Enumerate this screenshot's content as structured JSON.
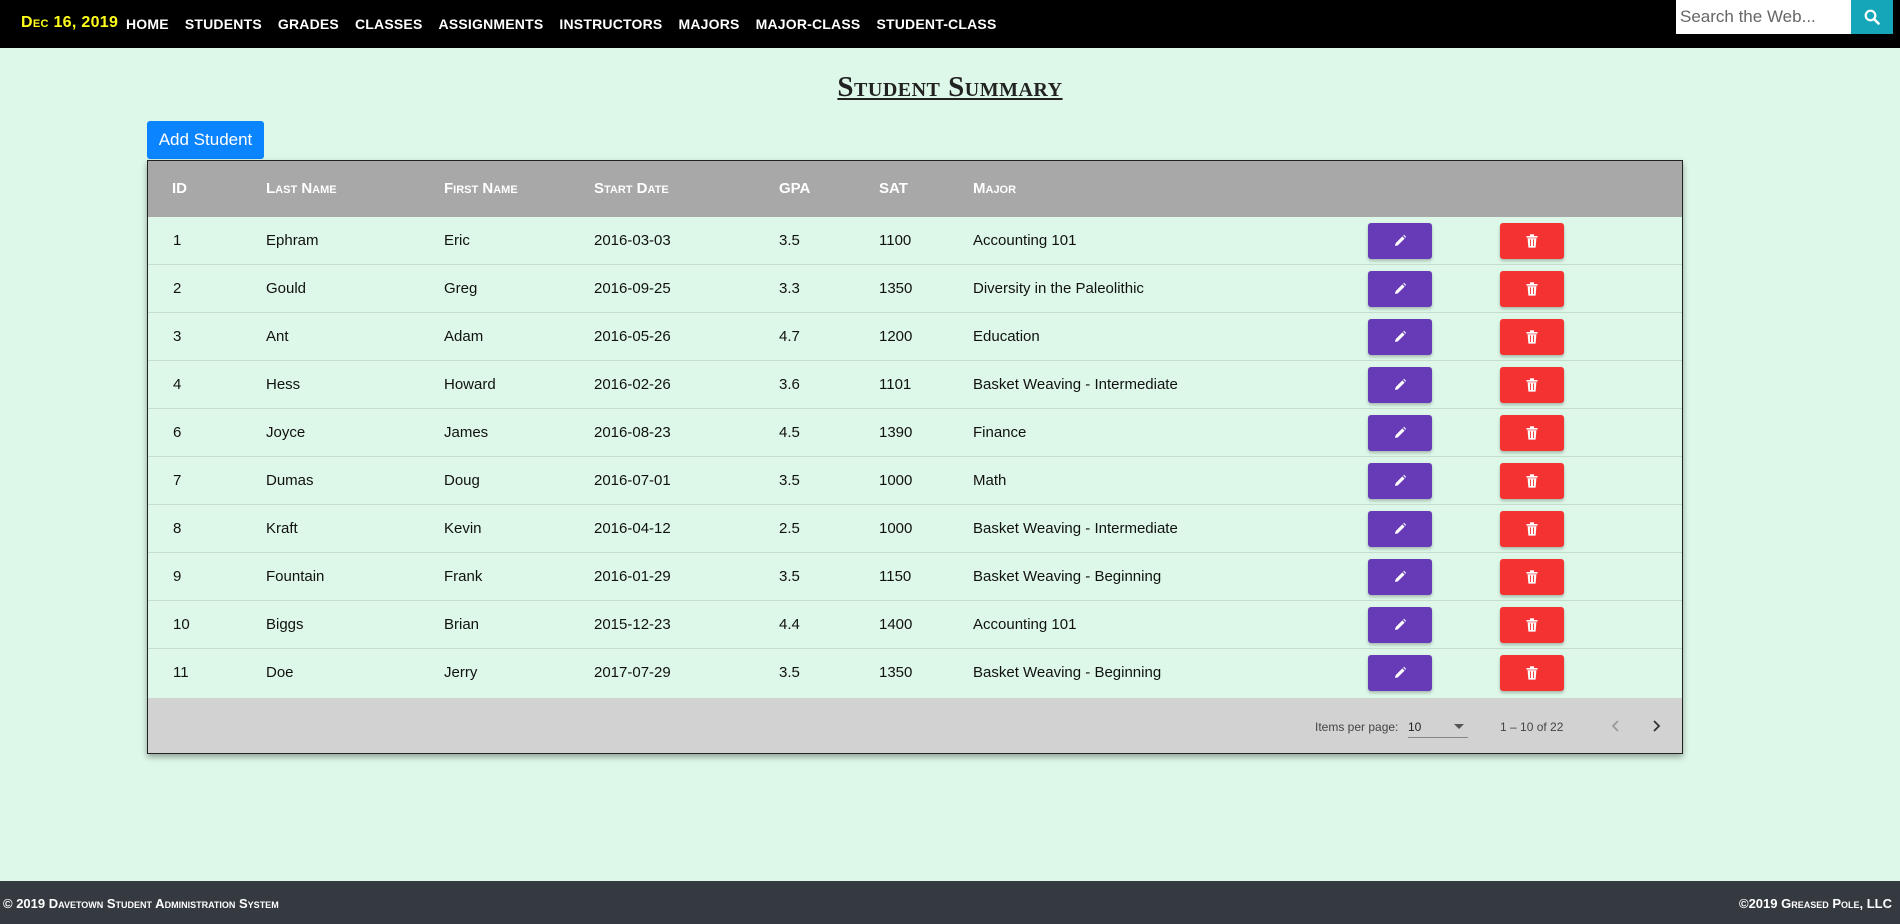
{
  "navbar": {
    "date": "Dec 16, 2019",
    "links": [
      "HOME",
      "STUDENTS",
      "GRADES",
      "CLASSES",
      "ASSIGNMENTS",
      "INSTRUCTORS",
      "MAJORS",
      "MAJOR-CLASS",
      "STUDENT-CLASS"
    ],
    "search_placeholder": "Search the Web...",
    "search_icon": "search-icon"
  },
  "page": {
    "title": "Student Summary",
    "add_button_label": "Add Student"
  },
  "table": {
    "headers": {
      "id": "ID",
      "last_name": "Last Name",
      "first_name": "First Name",
      "start_date": "Start Date",
      "gpa": "GPA",
      "sat": "SAT",
      "major": "Major"
    },
    "rows": [
      {
        "id": "1",
        "last_name": "Ephram",
        "first_name": "Eric",
        "start_date": "2016-03-03",
        "gpa": "3.5",
        "sat": "1100",
        "major": "Accounting 101"
      },
      {
        "id": "2",
        "last_name": "Gould",
        "first_name": "Greg",
        "start_date": "2016-09-25",
        "gpa": "3.3",
        "sat": "1350",
        "major": "Diversity in the Paleolithic"
      },
      {
        "id": "3",
        "last_name": "Ant",
        "first_name": "Adam",
        "start_date": "2016-05-26",
        "gpa": "4.7",
        "sat": "1200",
        "major": "Education"
      },
      {
        "id": "4",
        "last_name": "Hess",
        "first_name": "Howard",
        "start_date": "2016-02-26",
        "gpa": "3.6",
        "sat": "1101",
        "major": "Basket Weaving - Intermediate"
      },
      {
        "id": "6",
        "last_name": "Joyce",
        "first_name": "James",
        "start_date": "2016-08-23",
        "gpa": "4.5",
        "sat": "1390",
        "major": "Finance"
      },
      {
        "id": "7",
        "last_name": "Dumas",
        "first_name": "Doug",
        "start_date": "2016-07-01",
        "gpa": "3.5",
        "sat": "1000",
        "major": "Math"
      },
      {
        "id": "8",
        "last_name": "Kraft",
        "first_name": "Kevin",
        "start_date": "2016-04-12",
        "gpa": "2.5",
        "sat": "1000",
        "major": "Basket Weaving - Intermediate"
      },
      {
        "id": "9",
        "last_name": "Fountain",
        "first_name": "Frank",
        "start_date": "2016-01-29",
        "gpa": "3.5",
        "sat": "1150",
        "major": "Basket Weaving - Beginning"
      },
      {
        "id": "10",
        "last_name": "Biggs",
        "first_name": "Brian",
        "start_date": "2015-12-23",
        "gpa": "4.4",
        "sat": "1400",
        "major": "Accounting 101"
      },
      {
        "id": "11",
        "last_name": "Doe",
        "first_name": "Jerry",
        "start_date": "2017-07-29",
        "gpa": "3.5",
        "sat": "1350",
        "major": "Basket Weaving - Beginning"
      }
    ],
    "edit_icon": "pencil-icon",
    "delete_icon": "trash-icon"
  },
  "paginator": {
    "items_per_page_label": "Items per page:",
    "items_per_page": "10",
    "range_label": "1 – 10 of 22",
    "prev_icon": "chevron-left-icon",
    "next_icon": "chevron-right-icon"
  },
  "footer": {
    "left": "© 2019 Davetown Student Administration System",
    "right": "©2019 Greased Pole, LLC"
  },
  "colors": {
    "background": "#ddf8e9",
    "navbar": "#000000",
    "brand": "#ffff1a",
    "search_button": "#16a6b9",
    "add_button": "#0b84ff",
    "table_header": "#a8a8a8",
    "edit_button": "#673ab7",
    "delete_button": "#f43232",
    "paginator": "#d2d2d2",
    "footer": "#343a40"
  }
}
